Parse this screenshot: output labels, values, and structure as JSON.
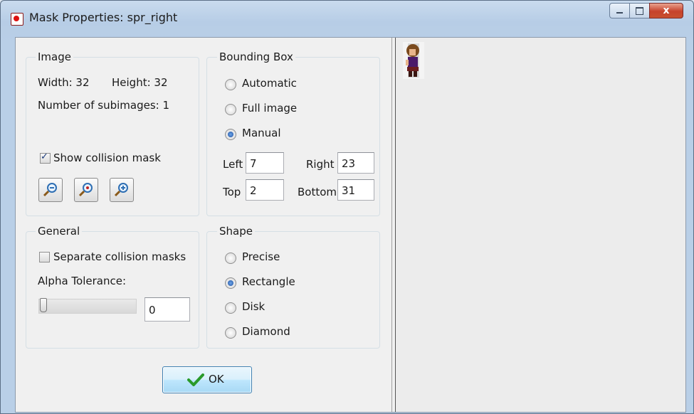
{
  "window": {
    "title": "Mask Properties: spr_right",
    "close_glyph": "x"
  },
  "image_group": {
    "title": "Image",
    "width_text": "Width: 32",
    "height_text": "Height: 32",
    "subimages_text": "Number of subimages: 1",
    "show_mask_label": "Show collision mask",
    "show_mask_checked": true,
    "zoom_buttons": [
      "zoom-out-icon",
      "zoom-reset-icon",
      "zoom-in-icon"
    ]
  },
  "bounding_box": {
    "title": "Bounding Box",
    "options": [
      "Automatic",
      "Full image",
      "Manual"
    ],
    "selected": "Manual",
    "left_label": "Left",
    "right_label": "Right",
    "top_label": "Top",
    "bottom_label": "Bottom",
    "left": "7",
    "right": "23",
    "top": "2",
    "bottom": "31"
  },
  "general_group": {
    "title": "General",
    "separate_label": "Separate collision masks",
    "separate_checked": false,
    "alpha_label": "Alpha Tolerance:",
    "alpha_value": "0",
    "alpha_slider_fraction": 0
  },
  "shape_group": {
    "title": "Shape",
    "options": [
      "Precise",
      "Rectangle",
      "Disk",
      "Diamond"
    ],
    "selected": "Rectangle"
  },
  "footer": {
    "ok_label": "OK"
  },
  "colors": {
    "titlebar": "#b9cfe7",
    "accent": "#1c4fa0",
    "ok_check": "#2a9a2a",
    "close_button": "#c6422c"
  }
}
